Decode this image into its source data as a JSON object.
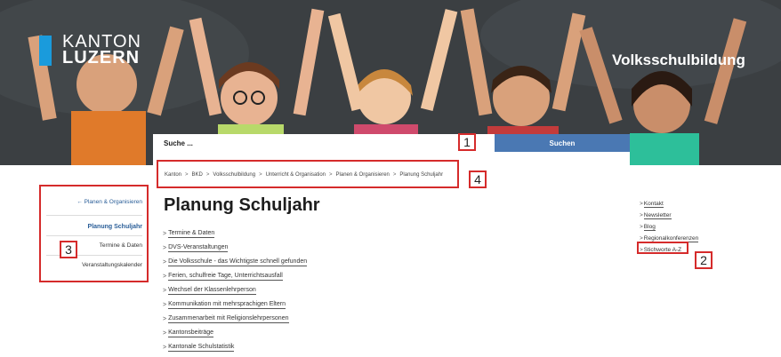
{
  "hero": {
    "logo_line1": "KANTON",
    "logo_line2": "LUZERN",
    "title": "Volksschulbildung"
  },
  "search": {
    "placeholder": "Suche ...",
    "button_label": "Suchen"
  },
  "breadcrumb": {
    "sep": ">",
    "items": [
      "Kanton",
      "BKD",
      "Volksschulbildung",
      "Unterricht & Organisation",
      "Planen & Organisieren",
      "Planung Schuljahr"
    ]
  },
  "main": {
    "title": "Planung Schuljahr",
    "links": [
      "Termine & Daten",
      "DVS-Veranstaltungen",
      "Die Volksschule - das Wichtigste schnell gefunden",
      "Ferien, schulfreie Tage, Unterrichtsausfall",
      "Wechsel der Klassenlehrperson",
      "Kommunikation mit mehrsprachigen Eltern",
      "Zusammenarbeit mit Religionslehrpersonen",
      "Kantonsbeiträge",
      "Kantonale Schulstatistik"
    ]
  },
  "leftnav": {
    "back_label": "Planen & Organisieren",
    "current": "Planung Schuljahr",
    "items": [
      "Termine & Daten",
      "Veranstaltungskalender"
    ]
  },
  "rightlinks": [
    "Kontakt",
    "Newsletter",
    "Blog",
    "Regionalkonferenzen",
    "Stichworte A-Z"
  ],
  "annotations": [
    "1",
    "2",
    "3",
    "4"
  ],
  "colors": {
    "accent": "#4a78b3",
    "logo_blue": "#1a9bdc",
    "annotation": "#d52b2b"
  }
}
